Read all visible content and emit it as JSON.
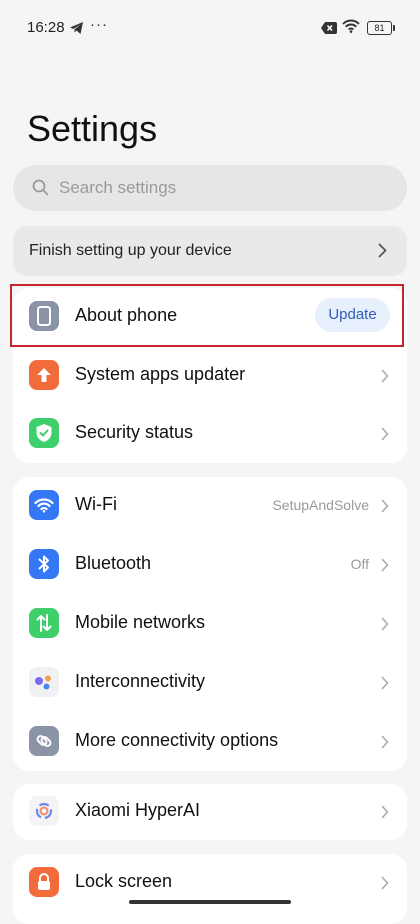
{
  "status_bar": {
    "time": "16:28",
    "overflow": "···",
    "battery": "81"
  },
  "title": "Settings",
  "search": {
    "placeholder": "Search settings"
  },
  "setup_banner": {
    "label": "Finish setting up your device"
  },
  "group1": [
    {
      "label": "About phone",
      "badge": "Update",
      "icon": "phone-icon"
    },
    {
      "label": "System apps updater",
      "icon": "upload-arrow-icon"
    },
    {
      "label": "Security status",
      "icon": "shield-check-icon"
    }
  ],
  "group2": [
    {
      "label": "Wi-Fi",
      "value": "SetupAndSolve",
      "icon": "wifi-icon"
    },
    {
      "label": "Bluetooth",
      "value": "Off",
      "icon": "bluetooth-icon"
    },
    {
      "label": "Mobile networks",
      "icon": "mobile-data-icon"
    },
    {
      "label": "Interconnectivity",
      "icon": "interconnectivity-icon"
    },
    {
      "label": "More connectivity options",
      "icon": "link-icon"
    }
  ],
  "group3": [
    {
      "label": "Xiaomi HyperAI",
      "icon": "hyperai-icon"
    }
  ],
  "group4": [
    {
      "label": "Lock screen",
      "icon": "lock-icon"
    }
  ],
  "colors": {
    "update_text": "#2f5fb8",
    "highlight": "#c6262e",
    "updater_icon": "#f26b3a",
    "security_icon": "#3ecf6a",
    "wifi_icon": "#3478f6",
    "bluetooth_icon": "#3478f6",
    "mobile_icon": "#3ecf6a",
    "lock_icon": "#f26b3a"
  }
}
